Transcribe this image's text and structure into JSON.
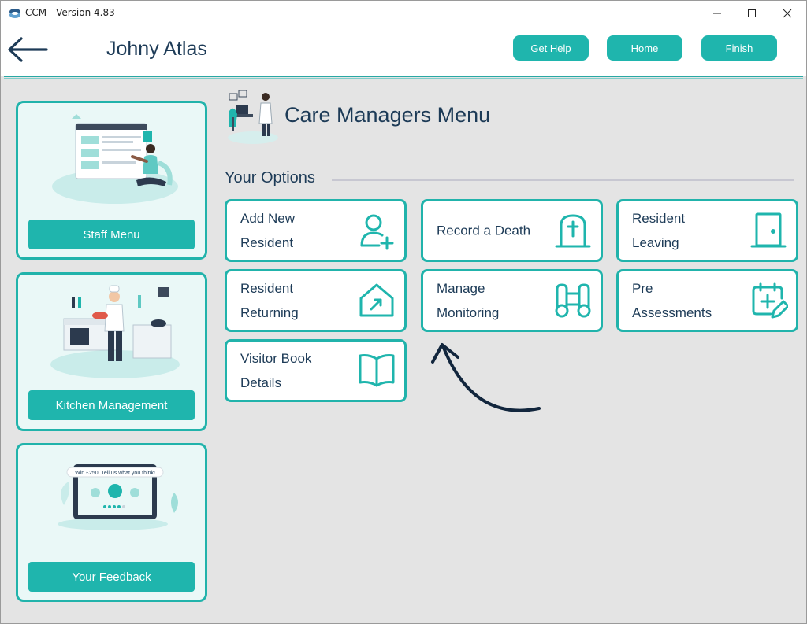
{
  "window": {
    "title": "CCM - Version 4.83"
  },
  "header": {
    "user_name": "Johny Atlas",
    "buttons": {
      "help": "Get Help",
      "home": "Home",
      "finish": "Finish"
    }
  },
  "sidebar": {
    "staff": {
      "label": "Staff Menu"
    },
    "kitchen": {
      "label": "Kitchen Management"
    },
    "feedback": {
      "label": "Your Feedback",
      "banner": "Win £250, Tell us what you think!"
    }
  },
  "main": {
    "title": "Care Managers Menu",
    "options_heading": "Your Options",
    "options": [
      {
        "line1": "Add New",
        "line2": "Resident",
        "icon": "add-user-icon"
      },
      {
        "line1": "Record a Death",
        "line2": "",
        "icon": "grave-icon"
      },
      {
        "line1": "Resident",
        "line2": "Leaving",
        "icon": "door-icon"
      },
      {
        "line1": "Resident",
        "line2": "Returning",
        "icon": "house-return-icon"
      },
      {
        "line1": "Manage",
        "line2": "Monitoring",
        "icon": "binoculars-icon"
      },
      {
        "line1": "Pre",
        "line2": "Assessments",
        "icon": "calendar-edit-icon"
      },
      {
        "line1": "Visitor Book",
        "line2": "Details",
        "icon": "open-book-icon"
      }
    ]
  },
  "colors": {
    "accent": "#1fb5ad",
    "text": "#1d3b57",
    "background": "#e4e4e4"
  }
}
